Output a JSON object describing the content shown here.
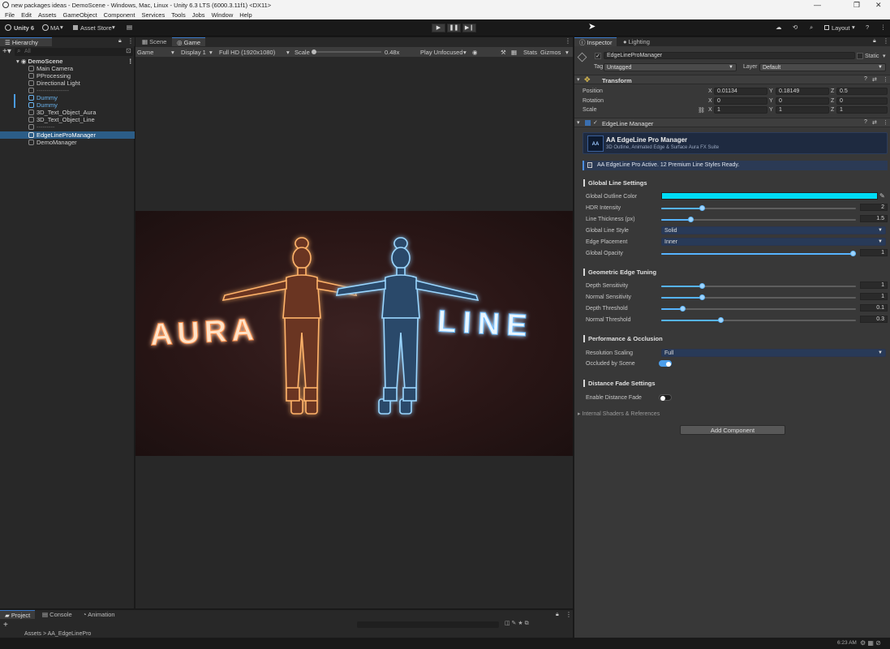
{
  "window": {
    "title": "new packages ideas - DemoScene - Windows, Mac, Linux - Unity 6.3 LTS (6000.3.11f1) <DX11>",
    "controls": [
      "—",
      "❐",
      "✕"
    ]
  },
  "menu": [
    "File",
    "Edit",
    "Assets",
    "GameObject",
    "Component",
    "Services",
    "Tools",
    "Jobs",
    "Window",
    "Help"
  ],
  "toolbar": {
    "unity_label": "Unity 6",
    "account_label": "MA",
    "asset_store_label": "Asset Store",
    "layout_label": "Layout"
  },
  "hierarchy": {
    "tab": "Hierarchy",
    "search_placeholder": "All",
    "scene": "DemoScene",
    "items": [
      {
        "label": "Main Camera"
      },
      {
        "label": "PProcessing"
      },
      {
        "label": "Directional Light"
      },
      {
        "label": "----------------"
      },
      {
        "label": "Dummy"
      },
      {
        "label": "Dummy"
      },
      {
        "label": "3D_Text_Object_Aura"
      },
      {
        "label": "3D_Text_Object_Line"
      },
      {
        "label": "---------"
      },
      {
        "label": "EdgeLineProManager"
      },
      {
        "label": "DemoManager"
      }
    ]
  },
  "game": {
    "tabs": [
      "Scene",
      "Game"
    ],
    "mode": "Game",
    "display": "Display 1",
    "resolution": "Full HD (1920x1080)",
    "scale_label": "Scale",
    "scale_value": "0.48x",
    "play_mode": "Play Unfocused",
    "stats": "Stats",
    "gizmos": "Gizmos",
    "text_left": "AURA",
    "text_right": "LINE",
    "colors": {
      "left_glow": "#ff8a3d",
      "right_glow": "#5fb8ff"
    }
  },
  "inspector": {
    "tabs": [
      "Inspector",
      "Lighting"
    ],
    "object_name": "EdgeLineProManager",
    "static_label": "Static",
    "tag_label": "Tag",
    "tag_value": "Untagged",
    "layer_label": "Layer",
    "layer_value": "Default",
    "transform": {
      "title": "Transform",
      "position_label": "Position",
      "rotation_label": "Rotation",
      "scale_label": "Scale",
      "position": {
        "x": "0.01134",
        "y": "0.18149",
        "z": "0.5"
      },
      "rotation": {
        "x": "0",
        "y": "0",
        "z": "0"
      },
      "scale": {
        "x": "1",
        "y": "1",
        "z": "1"
      }
    },
    "component": {
      "title": "EdgeLine Manager",
      "banner_title": "AA EdgeLine Pro Manager",
      "banner_subtitle": "3D Outline, Animated Edge & Surface Aura FX Suite",
      "info": "AA EdgeLine Pro Active. 12 Premium Line Styles Ready.",
      "global": {
        "title": "Global Line Settings",
        "outline_color_label": "Global Outline Color",
        "outline_color": "#00dcf6",
        "hdr_label": "HDR Intensity",
        "hdr_value": "2",
        "hdr_fraction": 0.2,
        "thickness_label": "Line Thickness (px)",
        "thickness_value": "1.5",
        "thickness_fraction": 0.14,
        "style_label": "Global Line Style",
        "style_value": "Solid",
        "placement_label": "Edge Placement",
        "placement_value": "Inner",
        "opacity_label": "Global Opacity",
        "opacity_value": "1",
        "opacity_fraction": 1.0
      },
      "geometric": {
        "title": "Geometric Edge Tuning",
        "depth_sens_label": "Depth Sensitivity",
        "depth_sens_value": "1",
        "depth_sens_fraction": 0.2,
        "normal_sens_label": "Normal Sensitivity",
        "normal_sens_value": "1",
        "normal_sens_fraction": 0.2,
        "depth_thr_label": "Depth Threshold",
        "depth_thr_value": "0.1",
        "depth_thr_fraction": 0.1,
        "normal_thr_label": "Normal Threshold",
        "normal_thr_value": "0.3",
        "normal_thr_fraction": 0.3
      },
      "performance": {
        "title": "Performance & Occlusion",
        "resolution_label": "Resolution Scaling",
        "resolution_value": "Full",
        "occluded_label": "Occluded by Scene",
        "occluded_on": true
      },
      "distance": {
        "title": "Distance Fade Settings",
        "enable_label": "Enable Distance Fade",
        "enable_on": false
      },
      "internal_label": "Internal Shaders & References"
    },
    "add_component": "Add Component"
  },
  "bottom": {
    "tabs": [
      "Project",
      "Console",
      "Animation"
    ],
    "breadcrumb": "Assets > AA_EdgeLinePro"
  },
  "status": {
    "time": "6:23 AM"
  }
}
